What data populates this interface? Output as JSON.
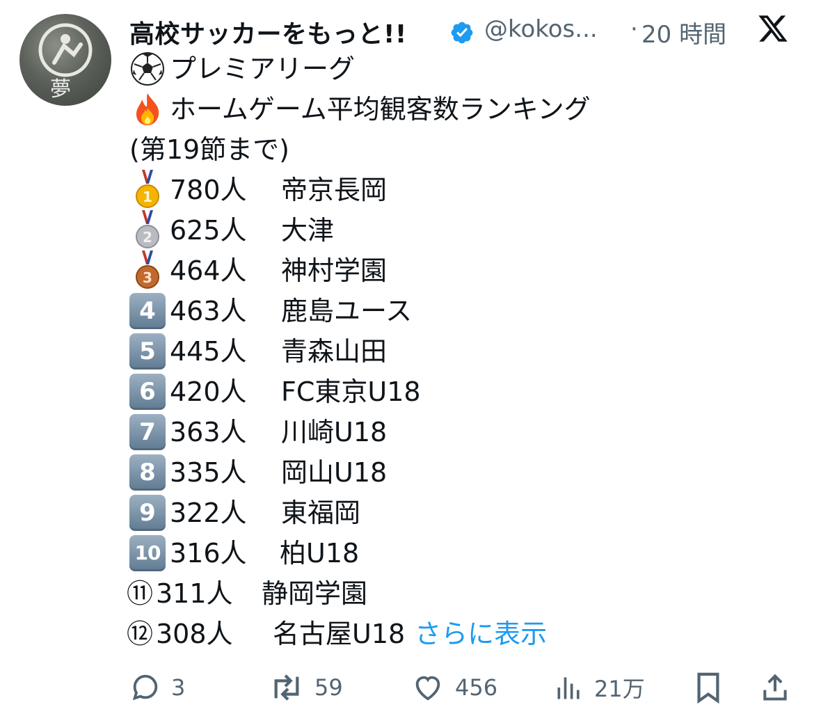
{
  "account": {
    "display_name": "高校サッカーをもっと!!",
    "handle": "@kokos...",
    "separator": "·",
    "time": "20 時間",
    "avatar_text": "夢"
  },
  "post": {
    "lines": [
      {
        "emoji": "soccer-ball",
        "text": "プレミアリーグ"
      },
      {
        "emoji": "fire",
        "text": "ホームゲーム平均観客数ランキング"
      },
      {
        "emoji": "",
        "text": "(第19節まで)"
      }
    ],
    "ranking": [
      {
        "rank": "1",
        "marker": "gold-medal",
        "count": "780人",
        "team": "帝京長岡"
      },
      {
        "rank": "2",
        "marker": "silver-medal",
        "count": "625人",
        "team": "大津"
      },
      {
        "rank": "3",
        "marker": "bronze-medal",
        "count": "464人",
        "team": "神村学園"
      },
      {
        "rank": "4",
        "marker": "keycap",
        "count": "463人",
        "team": "鹿島ユース"
      },
      {
        "rank": "5",
        "marker": "keycap",
        "count": "445人",
        "team": "青森山田"
      },
      {
        "rank": "6",
        "marker": "keycap",
        "count": "420人",
        "team": "FC東京U18"
      },
      {
        "rank": "7",
        "marker": "keycap",
        "count": "363人",
        "team": "川崎U18"
      },
      {
        "rank": "8",
        "marker": "keycap",
        "count": "335人",
        "team": "岡山U18"
      },
      {
        "rank": "9",
        "marker": "keycap",
        "count": "322人",
        "team": "東福岡"
      },
      {
        "rank": "10",
        "marker": "keycap",
        "count": "316人",
        "team": "柏U18"
      },
      {
        "rank": "⑪",
        "marker": "circled",
        "count": "311人",
        "team": "静岡学園"
      },
      {
        "rank": "⑫",
        "marker": "circled",
        "count": "308人",
        "team": "名古屋U18"
      }
    ],
    "see_more": "さらに表示"
  },
  "actions": {
    "replies": "3",
    "reposts": "59",
    "likes": "456",
    "views": "21万"
  },
  "colors": {
    "text": "#0f1419",
    "secondary": "#536471",
    "link": "#1d9bf0",
    "verified": "#1d9bf0"
  }
}
